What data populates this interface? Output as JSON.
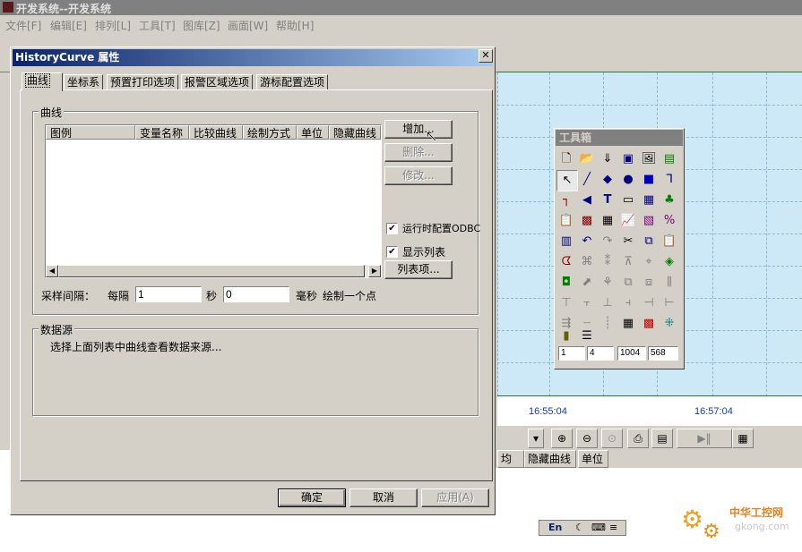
{
  "main_window": {
    "title": "开发系统--开发系统",
    "menu": [
      "文件[F]",
      "编辑[E]",
      "排列[L]",
      "工具[T]",
      "图库[Z]",
      "画面[W]",
      "帮助[H]"
    ]
  },
  "chart": {
    "time_labels": [
      "16:55:04",
      "16:57:04"
    ],
    "table_headers": [
      "均值",
      "隐藏曲线",
      "单位"
    ]
  },
  "toolbox": {
    "title": "工具箱",
    "fields": [
      "1",
      "4",
      "1004",
      "568"
    ]
  },
  "dialog": {
    "title": "HistoryCurve 属性",
    "close_label": "✕",
    "tabs": [
      "曲线",
      "坐标系",
      "预置打印选项",
      "报警区域选项",
      "游标配置选项"
    ],
    "curve_group": {
      "label": "曲线",
      "columns": [
        "图例",
        "变量名称",
        "比较曲线",
        "绘制方式",
        "单位",
        "隐藏曲线"
      ],
      "buttons": {
        "add": "增加...",
        "delete": "删除...",
        "modify": "修改...",
        "list_items": "列表项..."
      },
      "checkbox_odbc": "运行时配置ODBC",
      "checkbox_show_list": "显示列表"
    },
    "sampling": {
      "label": "采样间隔：",
      "every": "每隔",
      "seconds_value": "1",
      "seconds_unit": "秒",
      "ms_value": "0",
      "ms_unit": "毫秒",
      "suffix": "绘制一个点"
    },
    "datasource_group": {
      "label": "数据源",
      "hint": "选择上面列表中曲线查看数据来源..."
    },
    "footer": {
      "ok": "确定",
      "cancel": "取消",
      "apply": "应用(A)"
    }
  },
  "ime": {
    "label": "En"
  },
  "watermark": {
    "line1": "中华工控网",
    "line2": "gkong.com"
  }
}
